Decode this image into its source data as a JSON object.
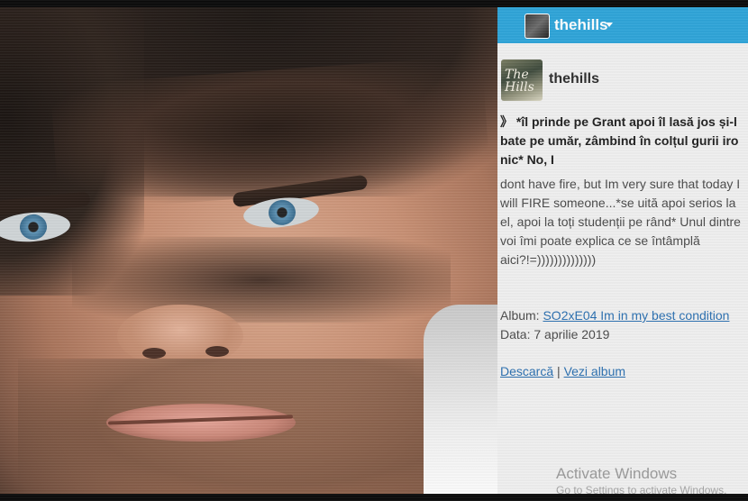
{
  "header": {
    "username": "thehills",
    "caret_icon": "chevron-down-icon"
  },
  "post": {
    "avatar_text": "The Hills",
    "username": "thehills",
    "quote": "》 *îl prinde pe Grant apoi îl lasă jos și-l bate pe umăr, zâmbind în colțul gurii ironic* No, I",
    "body": "dont have fire, but Im very sure that today I will FIRE someone...*se uită apoi serios la el, apoi la toți studenții pe rând* Unul dintre voi îmi poate explica ce se întâmplă aici?!=))))))))))))))",
    "album_label": "Album:",
    "album_link": "SO2xE04 Im in my best condition",
    "date_text": "Data: 7 aprilie 2019",
    "download_link": "Descarcă",
    "separator": "|",
    "view_album_link": "Vezi album"
  },
  "system": {
    "watermark_title": "Activate Windows",
    "watermark_sub": "Go to Settings to activate Windows."
  },
  "colors": {
    "header_bar": "#2ea4d8",
    "link": "#2a6fb0",
    "panel_bg": "#efefef"
  }
}
